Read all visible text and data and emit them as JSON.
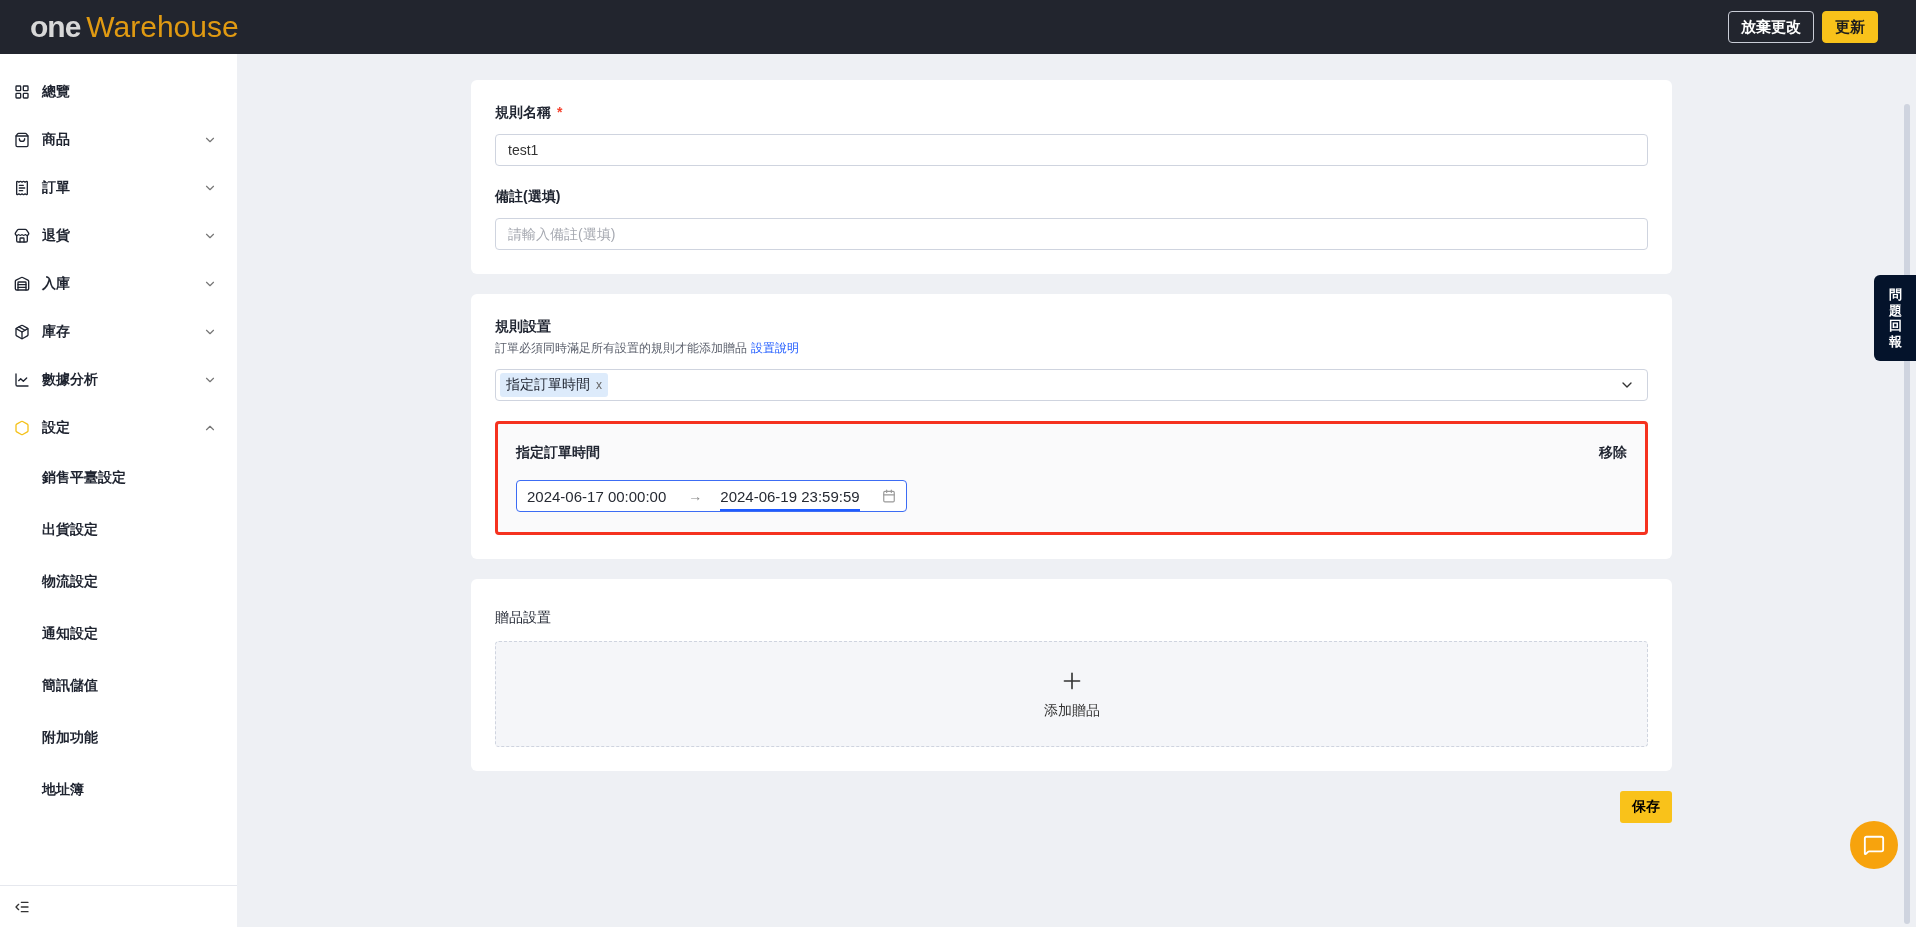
{
  "header": {
    "logo_left": "one",
    "logo_right": "Warehouse",
    "buttons": [
      {
        "label": "放棄更改",
        "kind": "outline"
      },
      {
        "label": "更新",
        "kind": "primary"
      }
    ]
  },
  "sidebar": {
    "items": [
      {
        "label": "總覽",
        "kind": "link",
        "selected": false
      },
      {
        "label": "商品",
        "kind": "group",
        "selected": false,
        "expanded": false
      },
      {
        "label": "訂單",
        "kind": "group",
        "selected": false,
        "expanded": false
      },
      {
        "label": "退貨",
        "kind": "group",
        "selected": false,
        "expanded": false
      },
      {
        "label": "入庫",
        "kind": "group",
        "selected": false,
        "expanded": false
      },
      {
        "label": "庫存",
        "kind": "group",
        "selected": false,
        "expanded": false
      },
      {
        "label": "數據分析",
        "kind": "group",
        "selected": false,
        "expanded": false
      },
      {
        "label": "設定",
        "kind": "group",
        "selected": true,
        "expanded": true,
        "children": [
          {
            "label": "銷售平臺設定"
          },
          {
            "label": "出貨設定"
          },
          {
            "label": "物流設定"
          },
          {
            "label": "通知設定"
          },
          {
            "label": "簡訊儲值"
          },
          {
            "label": "附加功能"
          },
          {
            "label": "地址簿"
          }
        ]
      }
    ]
  },
  "basic": {
    "name_label": "規則名稱",
    "required_mark": "*",
    "name_value": "test1",
    "note_label": "備註(選填)",
    "note_placeholder": "請輸入備註(選填)"
  },
  "rules": {
    "title": "規則設置",
    "hint": "訂單必須同時滿足所有設置的規則才能添加贈品",
    "help_link": "設置說明",
    "tags": [
      {
        "label": "指定訂單時間",
        "remove": "x"
      }
    ],
    "rule": {
      "title": "指定訂單時間",
      "remove": "移除",
      "range": [
        {
          "value": "2024-06-17 00:00:00",
          "selected": false
        },
        {
          "value": "2024-06-19 23:59:59",
          "selected": true
        }
      ],
      "separator": "→"
    }
  },
  "gifts": {
    "title": "贈品設置",
    "add_label": "添加贈品"
  },
  "save": "保存",
  "feedback_tab": "問題回報"
}
